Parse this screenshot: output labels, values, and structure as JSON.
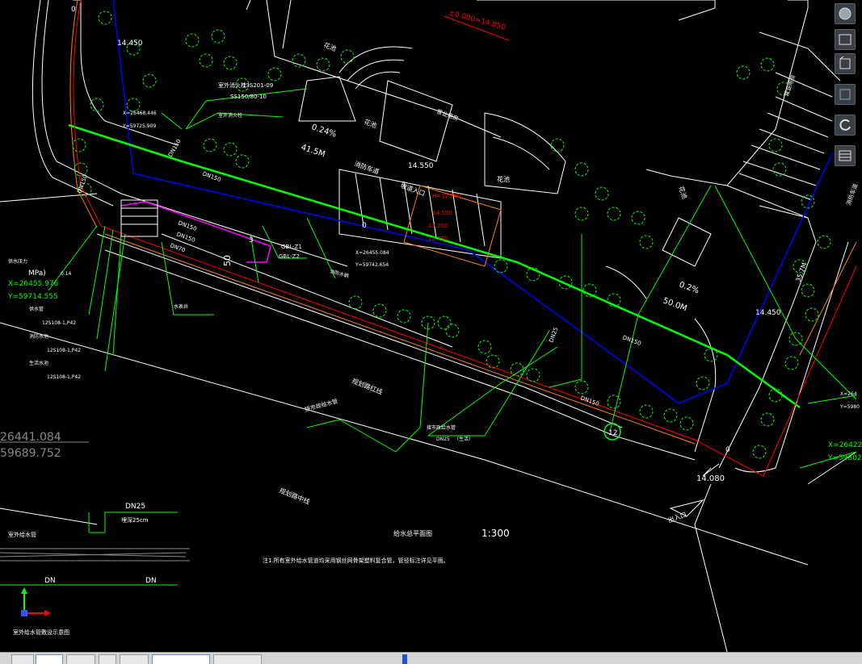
{
  "drawing": {
    "elev_zero": "±0.000=14.850",
    "elev_nw": "14.450",
    "elev_entry": "14.550",
    "elev_east": "14.450",
    "elev_se": "14.080",
    "flower_bed": "花池",
    "flower_bed_2": "花池",
    "flower_bed_3": "花池",
    "flower_bed_4": "花池",
    "building_label": "营业用房",
    "fire_lane": "消防车道",
    "fire_lane_east": "消防车道",
    "ramp_note": "坡道入口",
    "pipe_label_1": "DN150",
    "pipe_label_2": "DN150",
    "pipe_label_3": "DN150",
    "pipe_label_4": "DN150",
    "pipe_label_5": "DN150",
    "pipe_label_6": "DN25",
    "pipe_label_7": "DN70",
    "pipe_label_8": "DN150",
    "pipe_label_9": "DN150",
    "slope_1": "0.24%",
    "slope_2": "0.2%",
    "length_1": "41.5M",
    "length_2": "50.0M",
    "length_3": "35.7M",
    "coord_a_x": "X=26468.446",
    "coord_a_y": "Y=59725.909",
    "coord_b_x": "X=26455.084",
    "coord_b_y": "Y=59742.654",
    "coord_c_x": "X=26455.976",
    "coord_c_y": "Y=59714.555",
    "coord_d_x": "X=26422",
    "coord_d_y": "Y=59802",
    "coord_e_x": "X=264",
    "coord_e_y": "Y=5980",
    "coord_big_1": "26441.084",
    "coord_big_2": "59689.752",
    "meter_label": "室外消火栓",
    "meter_std": "13S201-09",
    "meter_std2": "SS150/80-10",
    "pressure_label": "供水压力",
    "pressure_unit": "MPa)",
    "pressure_val": "0.14",
    "std_1": "12S108-1,P42",
    "std_2": "12S108-1,P42",
    "std_3": "12S108-1,P42",
    "valve_1": "GBL-Z1",
    "valve_2": "GBL-Z2",
    "road_red_line": "规划路红线",
    "road_center": "规划路中线",
    "pipe_note": "接市政给水管",
    "text_mid_1": "接市政给水管",
    "text_mid_2": "DN25",
    "text_mid_3": "（生活）",
    "circle_num": "12",
    "exit_label": "出入口",
    "legend_dn25": "DN25",
    "legend_depth": "埋深25cm",
    "legend_caption": "室外给水管",
    "legend_dn": "DN",
    "legend_dn_2": "DN",
    "legend_title": "室外给水管敷设示意图",
    "plan_title": "给水总平面图",
    "plan_scale": "1:300",
    "note_text": "注1.所有室外给水管道均采用钢丝网骨架塑料复合管，管径标注详见平面。",
    "zero_1": "0",
    "zero_2": "0",
    "zero_3": "0",
    "n3": "3",
    "n50": "50",
    "building_e": "营业用房",
    "pump_label": "水表井",
    "hydrant_label": "消防水鹤",
    "hydrant_label_2": "室外消火栓",
    "sub_1": "供水管",
    "sub_2": "消防水池",
    "sub_3": "生活水池",
    "elev_red_1": "H=12.750",
    "elev_red_2": "14.550",
    "elev_red_3": "13.250",
    "elev_red_4": "12.750"
  },
  "status_bar": {
    "tabs": [
      "",
      "",
      "",
      "",
      "",
      "",
      ""
    ]
  },
  "colors": {
    "green": "#00ff00",
    "blue": "#0000ff",
    "white": "#ffffff",
    "red": "#ff0000",
    "yellow": "#ffff00",
    "magenta": "#ff00ff",
    "orange": "#ff8000",
    "cyan": "#00ffff"
  }
}
